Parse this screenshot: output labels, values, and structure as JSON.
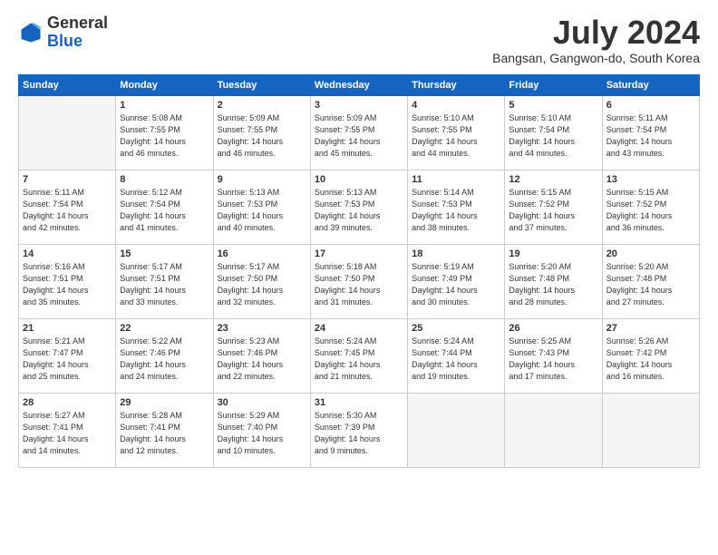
{
  "logo": {
    "general": "General",
    "blue": "Blue"
  },
  "title": "July 2024",
  "location": "Bangsan, Gangwon-do, South Korea",
  "days_header": [
    "Sunday",
    "Monday",
    "Tuesday",
    "Wednesday",
    "Thursday",
    "Friday",
    "Saturday"
  ],
  "weeks": [
    [
      {
        "day": "",
        "sunrise": "",
        "sunset": "",
        "daylight": ""
      },
      {
        "day": "1",
        "sunrise": "Sunrise: 5:08 AM",
        "sunset": "Sunset: 7:55 PM",
        "daylight": "Daylight: 14 hours and 46 minutes."
      },
      {
        "day": "2",
        "sunrise": "Sunrise: 5:09 AM",
        "sunset": "Sunset: 7:55 PM",
        "daylight": "Daylight: 14 hours and 46 minutes."
      },
      {
        "day": "3",
        "sunrise": "Sunrise: 5:09 AM",
        "sunset": "Sunset: 7:55 PM",
        "daylight": "Daylight: 14 hours and 45 minutes."
      },
      {
        "day": "4",
        "sunrise": "Sunrise: 5:10 AM",
        "sunset": "Sunset: 7:55 PM",
        "daylight": "Daylight: 14 hours and 44 minutes."
      },
      {
        "day": "5",
        "sunrise": "Sunrise: 5:10 AM",
        "sunset": "Sunset: 7:54 PM",
        "daylight": "Daylight: 14 hours and 44 minutes."
      },
      {
        "day": "6",
        "sunrise": "Sunrise: 5:11 AM",
        "sunset": "Sunset: 7:54 PM",
        "daylight": "Daylight: 14 hours and 43 minutes."
      }
    ],
    [
      {
        "day": "7",
        "sunrise": "Sunrise: 5:11 AM",
        "sunset": "Sunset: 7:54 PM",
        "daylight": "Daylight: 14 hours and 42 minutes."
      },
      {
        "day": "8",
        "sunrise": "Sunrise: 5:12 AM",
        "sunset": "Sunset: 7:54 PM",
        "daylight": "Daylight: 14 hours and 41 minutes."
      },
      {
        "day": "9",
        "sunrise": "Sunrise: 5:13 AM",
        "sunset": "Sunset: 7:53 PM",
        "daylight": "Daylight: 14 hours and 40 minutes."
      },
      {
        "day": "10",
        "sunrise": "Sunrise: 5:13 AM",
        "sunset": "Sunset: 7:53 PM",
        "daylight": "Daylight: 14 hours and 39 minutes."
      },
      {
        "day": "11",
        "sunrise": "Sunrise: 5:14 AM",
        "sunset": "Sunset: 7:53 PM",
        "daylight": "Daylight: 14 hours and 38 minutes."
      },
      {
        "day": "12",
        "sunrise": "Sunrise: 5:15 AM",
        "sunset": "Sunset: 7:52 PM",
        "daylight": "Daylight: 14 hours and 37 minutes."
      },
      {
        "day": "13",
        "sunrise": "Sunrise: 5:15 AM",
        "sunset": "Sunset: 7:52 PM",
        "daylight": "Daylight: 14 hours and 36 minutes."
      }
    ],
    [
      {
        "day": "14",
        "sunrise": "Sunrise: 5:16 AM",
        "sunset": "Sunset: 7:51 PM",
        "daylight": "Daylight: 14 hours and 35 minutes."
      },
      {
        "day": "15",
        "sunrise": "Sunrise: 5:17 AM",
        "sunset": "Sunset: 7:51 PM",
        "daylight": "Daylight: 14 hours and 33 minutes."
      },
      {
        "day": "16",
        "sunrise": "Sunrise: 5:17 AM",
        "sunset": "Sunset: 7:50 PM",
        "daylight": "Daylight: 14 hours and 32 minutes."
      },
      {
        "day": "17",
        "sunrise": "Sunrise: 5:18 AM",
        "sunset": "Sunset: 7:50 PM",
        "daylight": "Daylight: 14 hours and 31 minutes."
      },
      {
        "day": "18",
        "sunrise": "Sunrise: 5:19 AM",
        "sunset": "Sunset: 7:49 PM",
        "daylight": "Daylight: 14 hours and 30 minutes."
      },
      {
        "day": "19",
        "sunrise": "Sunrise: 5:20 AM",
        "sunset": "Sunset: 7:48 PM",
        "daylight": "Daylight: 14 hours and 28 minutes."
      },
      {
        "day": "20",
        "sunrise": "Sunrise: 5:20 AM",
        "sunset": "Sunset: 7:48 PM",
        "daylight": "Daylight: 14 hours and 27 minutes."
      }
    ],
    [
      {
        "day": "21",
        "sunrise": "Sunrise: 5:21 AM",
        "sunset": "Sunset: 7:47 PM",
        "daylight": "Daylight: 14 hours and 25 minutes."
      },
      {
        "day": "22",
        "sunrise": "Sunrise: 5:22 AM",
        "sunset": "Sunset: 7:46 PM",
        "daylight": "Daylight: 14 hours and 24 minutes."
      },
      {
        "day": "23",
        "sunrise": "Sunrise: 5:23 AM",
        "sunset": "Sunset: 7:46 PM",
        "daylight": "Daylight: 14 hours and 22 minutes."
      },
      {
        "day": "24",
        "sunrise": "Sunrise: 5:24 AM",
        "sunset": "Sunset: 7:45 PM",
        "daylight": "Daylight: 14 hours and 21 minutes."
      },
      {
        "day": "25",
        "sunrise": "Sunrise: 5:24 AM",
        "sunset": "Sunset: 7:44 PM",
        "daylight": "Daylight: 14 hours and 19 minutes."
      },
      {
        "day": "26",
        "sunrise": "Sunrise: 5:25 AM",
        "sunset": "Sunset: 7:43 PM",
        "daylight": "Daylight: 14 hours and 17 minutes."
      },
      {
        "day": "27",
        "sunrise": "Sunrise: 5:26 AM",
        "sunset": "Sunset: 7:42 PM",
        "daylight": "Daylight: 14 hours and 16 minutes."
      }
    ],
    [
      {
        "day": "28",
        "sunrise": "Sunrise: 5:27 AM",
        "sunset": "Sunset: 7:41 PM",
        "daylight": "Daylight: 14 hours and 14 minutes."
      },
      {
        "day": "29",
        "sunrise": "Sunrise: 5:28 AM",
        "sunset": "Sunset: 7:41 PM",
        "daylight": "Daylight: 14 hours and 12 minutes."
      },
      {
        "day": "30",
        "sunrise": "Sunrise: 5:29 AM",
        "sunset": "Sunset: 7:40 PM",
        "daylight": "Daylight: 14 hours and 10 minutes."
      },
      {
        "day": "31",
        "sunrise": "Sunrise: 5:30 AM",
        "sunset": "Sunset: 7:39 PM",
        "daylight": "Daylight: 14 hours and 9 minutes."
      },
      {
        "day": "",
        "sunrise": "",
        "sunset": "",
        "daylight": ""
      },
      {
        "day": "",
        "sunrise": "",
        "sunset": "",
        "daylight": ""
      },
      {
        "day": "",
        "sunrise": "",
        "sunset": "",
        "daylight": ""
      }
    ]
  ]
}
